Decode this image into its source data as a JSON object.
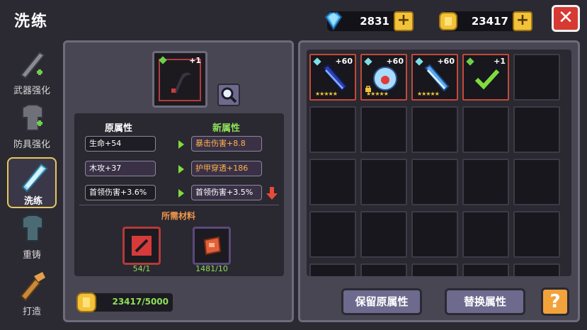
{
  "header": {
    "title": "洗练",
    "gems": "2831",
    "coins": "23417"
  },
  "sidebar": [
    {
      "label": "武器强化",
      "icon": "sword-icon"
    },
    {
      "label": "防具强化",
      "icon": "armor-icon"
    },
    {
      "label": "洗练",
      "icon": "crystal-sword-icon",
      "active": true
    },
    {
      "label": "重铸",
      "icon": "armor-reforge-icon"
    },
    {
      "label": "打造",
      "icon": "forge-icon"
    }
  ],
  "selected_item": {
    "level": "+1"
  },
  "attributes": {
    "original_header": "原属性",
    "new_header": "新属性",
    "rows": [
      {
        "old": "生命+54",
        "new": "暴击伤害+8.8"
      },
      {
        "old": "木攻+37",
        "new": "护甲穿透+186"
      },
      {
        "old": "首领伤害+3.6%",
        "new": "首领伤害+3.5%"
      }
    ]
  },
  "materials": {
    "title": "所需材料",
    "items": [
      {
        "count": "54/1"
      },
      {
        "count": "1481/10"
      }
    ]
  },
  "gold_cost": "23417/5000",
  "inventory": [
    {
      "level": "+60",
      "stars": "★★★★★"
    },
    {
      "level": "+60",
      "stars": "★★★★★"
    },
    {
      "level": "+60",
      "stars": "★★★★★"
    },
    {
      "level": "+1",
      "selected": true
    }
  ],
  "buttons": {
    "keep": "保留原属性",
    "replace": "替换属性",
    "help": "?"
  }
}
